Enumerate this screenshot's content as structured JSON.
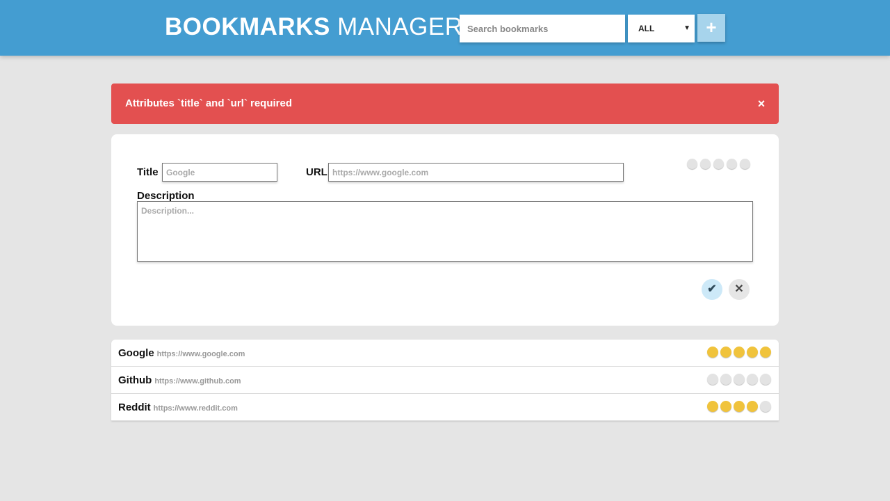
{
  "header": {
    "brand_bold": "BOOKMARKS",
    "brand_light": "MANAGER",
    "search_placeholder": "Search bookmarks",
    "filter_value": "ALL",
    "add_label": "+"
  },
  "alert": {
    "message": "Attributes `title` and `url` required",
    "close_label": "×"
  },
  "form": {
    "title_label": "Title",
    "title_placeholder": "Google",
    "url_label": "URL",
    "url_placeholder": "https://www.google.com",
    "description_label": "Description",
    "description_placeholder": "Description...",
    "rating": 0,
    "confirm_label": "✔",
    "cancel_label": "✕"
  },
  "bookmarks": [
    {
      "title": "Google",
      "url": "https://www.google.com",
      "rating": 5
    },
    {
      "title": "Github",
      "url": "https://www.github.com",
      "rating": 0
    },
    {
      "title": "Reddit",
      "url": "https://www.reddit.com",
      "rating": 4
    }
  ],
  "colors": {
    "header_bg": "#449dd1",
    "alert_bg": "#e35050",
    "star_on": "#f0c33c",
    "star_off": "#e3e3e3"
  }
}
